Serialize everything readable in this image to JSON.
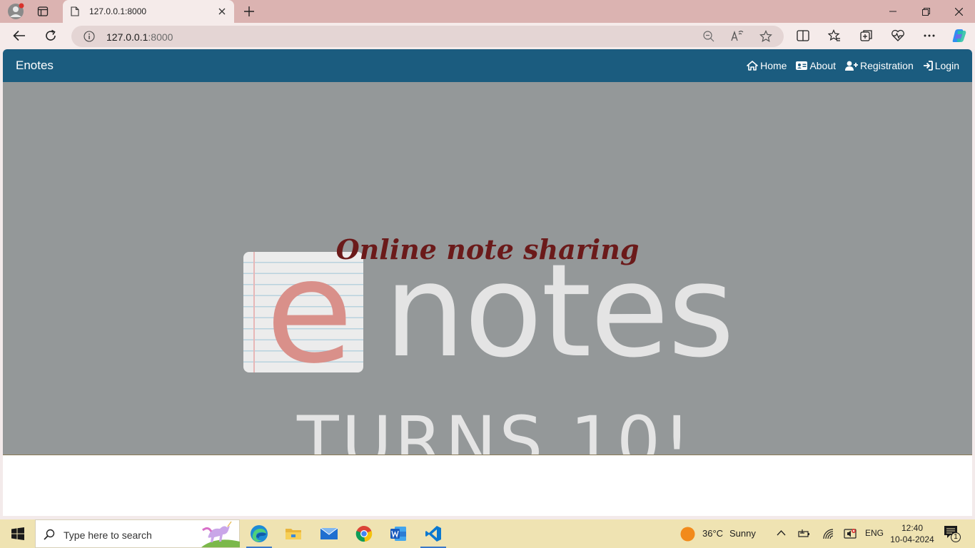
{
  "browser": {
    "tab": {
      "title": "127.0.0.1:8000"
    },
    "address": {
      "host": "127.0.0.1",
      "port": ":8000"
    }
  },
  "navbar": {
    "brand": "Enotes",
    "links": [
      {
        "label": "Home",
        "icon": "home-icon"
      },
      {
        "label": "About",
        "icon": "id-card-icon"
      },
      {
        "label": "Registration",
        "icon": "user-plus-icon"
      },
      {
        "label": "Login",
        "icon": "sign-in-icon"
      }
    ]
  },
  "hero": {
    "tagline": "Online note sharing",
    "logo_e": "e",
    "logo_word": "notes",
    "turns_text": "TURNS 10!"
  },
  "taskbar": {
    "search_placeholder": "Type here to search",
    "weather": {
      "temp": "36°C",
      "condition": "Sunny"
    },
    "language": "ENG",
    "time": "12:40",
    "date": "10-04-2024",
    "notification_count": "1"
  },
  "colors": {
    "navbar": "#1b5c7f",
    "hero_bg": "#949899",
    "tagline": "#6b1a1a",
    "tab_strip": "#dbb3b1",
    "taskbar": "#efe3b2"
  }
}
